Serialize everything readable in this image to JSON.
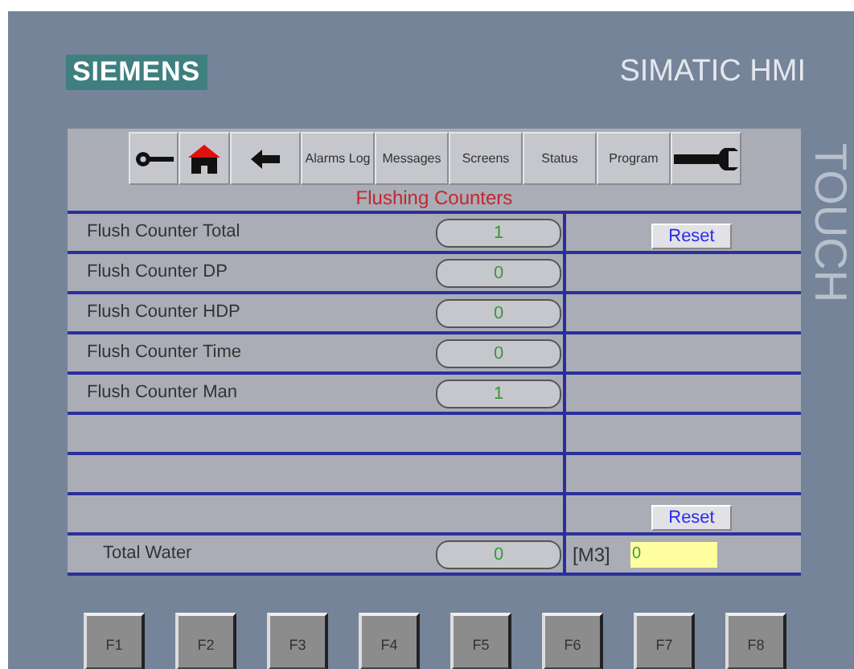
{
  "brand": {
    "logo": "SIEMENS",
    "product": "SIMATIC HMI",
    "side_label": "TOUCH"
  },
  "toolbar": [
    {
      "kind": "key"
    },
    {
      "kind": "home"
    },
    {
      "kind": "back"
    },
    {
      "kind": "text",
      "label": "Alarms Log"
    },
    {
      "kind": "text",
      "label": "Messages"
    },
    {
      "kind": "text",
      "label": "Screens"
    },
    {
      "kind": "text",
      "label": "Status"
    },
    {
      "kind": "text",
      "label": "Program"
    },
    {
      "kind": "wrench"
    }
  ],
  "screen_title": "Flushing Counters",
  "rows": [
    {
      "kind": "counter",
      "label": "Flush Counter Total",
      "value": "1",
      "action": "Reset"
    },
    {
      "kind": "counter",
      "label": "Flush Counter DP",
      "value": "0"
    },
    {
      "kind": "counter",
      "label": "Flush Counter HDP",
      "value": "0"
    },
    {
      "kind": "counter",
      "label": "Flush Counter Time",
      "value": "0"
    },
    {
      "kind": "counter",
      "label": "Flush Counter Man",
      "value": "1"
    },
    {
      "kind": "empty"
    },
    {
      "kind": "empty"
    },
    {
      "kind": "empty",
      "action": "Reset"
    },
    {
      "kind": "total",
      "label": "Total Water",
      "value": "0",
      "unit": "[M3]",
      "input_value": "0"
    }
  ],
  "function_keys": [
    "F1",
    "F2",
    "F3",
    "F4",
    "F5",
    "F6",
    "F7",
    "F8"
  ]
}
